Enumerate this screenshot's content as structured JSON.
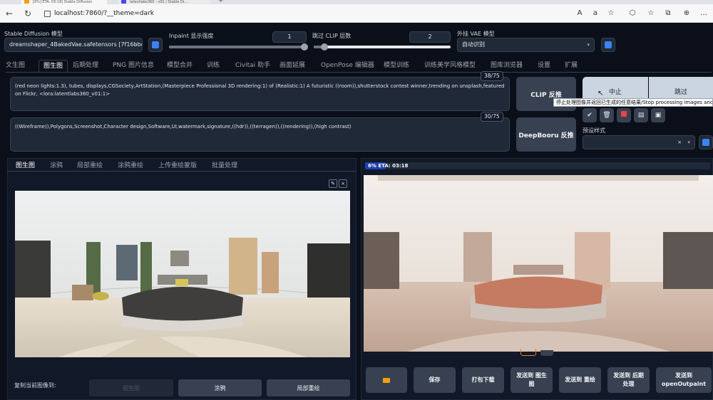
{
  "browser": {
    "tabs": [
      "[6%] ETA: 03:18] Stable Diffusion",
      "latentlabs360 - v01 | Stable Di..."
    ],
    "url": "localhost:7860/?__theme=dark"
  },
  "top": {
    "model_label": "Stable Diffusion 模型",
    "model_value": "dreamshaper_4BakedVae.safetensors [7f16bbcd8",
    "inpaint_label": "Inpaint 显示强度",
    "inpaint_value": "1",
    "inpaint_fraction": 1.0,
    "clip_label": "跳过 CLIP 层数",
    "clip_value": "2",
    "clip_fraction": 0.08,
    "vae_label": "外挂 VAE 模型",
    "vae_value": "自动识别"
  },
  "main_tabs": [
    "文生图",
    "图生图",
    "后期处理",
    "PNG 图片信息",
    "模型合并",
    "训练",
    "Civitai 助手",
    "画面延展",
    "OpenPose 编辑器",
    "模型训练",
    "训练美学风格模型",
    "图库浏览器",
    "设置",
    "扩展"
  ],
  "prompt": {
    "positive": "(red neon lights:1.3), tubes, displays,CGSociety,ArtStation,(Masterpiece Professional 3D rendering:1) of (Realistic:1)  A futuristic ((room)),shutterstock contest winner,trending on unsplash,featured on Flickr, <lora:latentlabs360_v01:1>",
    "positive_count": "38/75",
    "negative": "((Wireframe)),Polygons,Screenshot,Character design,Software,UI,watermark,signature,((hdr)),((terragen)),((rendering)),(high contrast)",
    "negative_count": "30/75"
  },
  "buttons": {
    "clip": "CLIP 反推",
    "deepbooru": "DeepBooru 反推",
    "interrupt": "中止",
    "skip": "跳过",
    "tooltip": "停止处理图像并返回已生成的任意结果/Stop processing images and return",
    "style_label": "预设样式"
  },
  "sub_tabs": [
    "图生图",
    "涂鸦",
    "局部重绘",
    "涂鸦重绘",
    "上传重绘蒙版",
    "批量处理"
  ],
  "progress": {
    "text": "6% ETA: 03:18",
    "fraction": 0.06
  },
  "copy": {
    "label": "复制当前图像到:",
    "buttons": [
      "图生图",
      "涂鸦",
      "局部重绘"
    ]
  },
  "actions": [
    "",
    "保存",
    "打包下载",
    "发送到 图生图",
    "发送到 重绘",
    "发送到 后期处理",
    "发送到 openOutpaint"
  ]
}
